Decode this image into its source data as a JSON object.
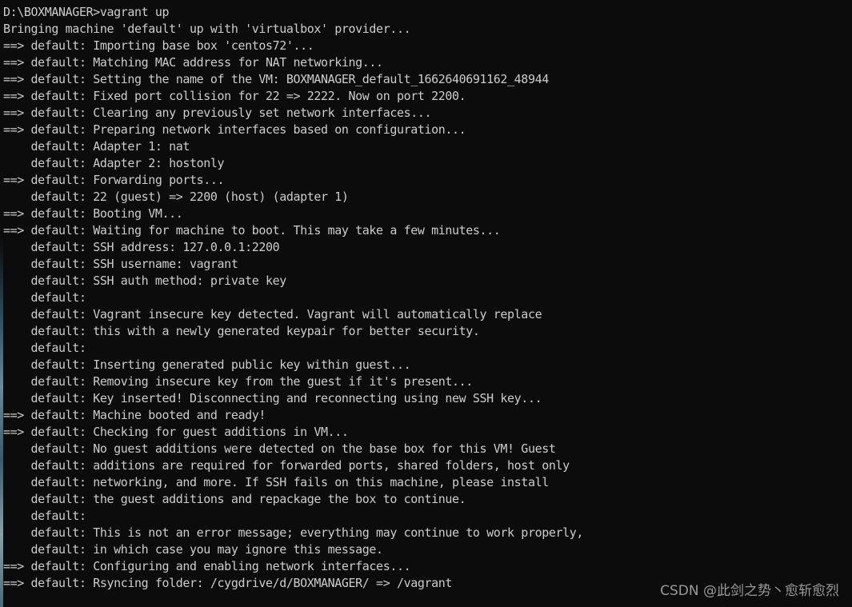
{
  "terminal": {
    "lines": [
      "D:\\BOXMANAGER>vagrant up",
      "Bringing machine 'default' up with 'virtualbox' provider...",
      "==> default: Importing base box 'centos72'...",
      "==> default: Matching MAC address for NAT networking...",
      "==> default: Setting the name of the VM: BOXMANAGER_default_1662640691162_48944",
      "==> default: Fixed port collision for 22 => 2222. Now on port 2200.",
      "==> default: Clearing any previously set network interfaces...",
      "==> default: Preparing network interfaces based on configuration...",
      "    default: Adapter 1: nat",
      "    default: Adapter 2: hostonly",
      "==> default: Forwarding ports...",
      "    default: 22 (guest) => 2200 (host) (adapter 1)",
      "==> default: Booting VM...",
      "==> default: Waiting for machine to boot. This may take a few minutes...",
      "    default: SSH address: 127.0.0.1:2200",
      "    default: SSH username: vagrant",
      "    default: SSH auth method: private key",
      "    default:",
      "    default: Vagrant insecure key detected. Vagrant will automatically replace",
      "    default: this with a newly generated keypair for better security.",
      "    default:",
      "    default: Inserting generated public key within guest...",
      "    default: Removing insecure key from the guest if it's present...",
      "    default: Key inserted! Disconnecting and reconnecting using new SSH key...",
      "==> default: Machine booted and ready!",
      "==> default: Checking for guest additions in VM...",
      "    default: No guest additions were detected on the base box for this VM! Guest",
      "    default: additions are required for forwarded ports, shared folders, host only",
      "    default: networking, and more. If SSH fails on this machine, please install",
      "    default: the guest additions and repackage the box to continue.",
      "    default:",
      "    default: This is not an error message; everything may continue to work properly,",
      "    default: in which case you may ignore this message.",
      "==> default: Configuring and enabling network interfaces...",
      "==> default: Rsyncing folder: /cygdrive/d/BOXMANAGER/ => /vagrant"
    ]
  },
  "watermark": "CSDN @此剑之势丶愈斩愈烈",
  "colors": {
    "background": "#0c0c0c",
    "text": "#cccccc",
    "watermark": "#9a9a9a"
  }
}
